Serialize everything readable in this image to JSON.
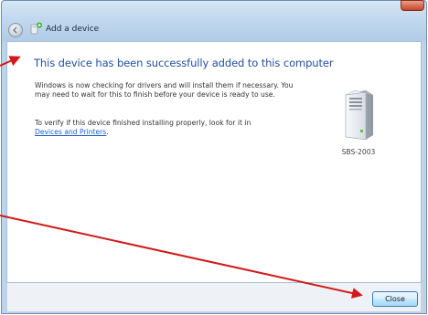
{
  "window": {
    "title": "Add a device"
  },
  "content": {
    "heading": "This device has been successfully added to this computer",
    "paragraph1": "Windows is now checking for drivers and will install them if necessary. You may need to wait for this to finish before your device is ready to use.",
    "paragraph2_prefix": "To verify if this device finished installing properly, look for it in",
    "paragraph2_link": "Devices and Printers",
    "paragraph2_suffix": "."
  },
  "device": {
    "label": "SBS-2003",
    "icon": "computer-tower-icon"
  },
  "buttons": {
    "close_label": "Close"
  },
  "colors": {
    "heading": "#1f4e9d",
    "link": "#1a5fc4",
    "annotation": "#d11a1a"
  }
}
